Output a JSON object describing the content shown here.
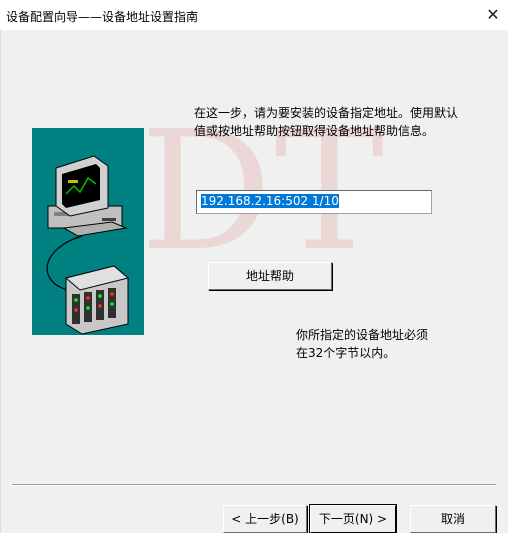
{
  "window": {
    "title": "设备配置向导——设备地址设置指南",
    "close_glyph": "✕"
  },
  "watermark": "DT",
  "instruction": "在这一步，请为要安装的设备指定地址。使用默认值或按地址帮助按钮取得设备地址帮助信息。",
  "address_field": {
    "value": "192.168.2.16:502 1/10"
  },
  "buttons": {
    "help": "地址帮助",
    "back": "< 上一步(B)",
    "next": "下一页(N) >",
    "cancel": "取消"
  },
  "note_lines": [
    "你所指定的设备地址必须",
    "在32个字节以内。"
  ],
  "colors": {
    "illustration_bg": "#008080",
    "selection": "#0078d7"
  }
}
